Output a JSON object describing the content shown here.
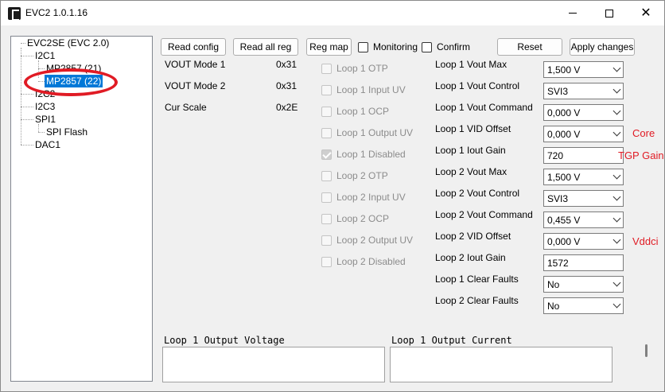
{
  "window": {
    "title": "EVC2 1.0.1.16"
  },
  "tree": {
    "root": "EVC2SE (EVC 2.0)",
    "i2c1": "I2C1",
    "mp2857_21": "MP2857 (21)",
    "mp2857_22": "MP2857 (22)",
    "i2c2": "I2C2",
    "i2c3": "I2C3",
    "spi1": "SPI1",
    "spi_flash": "SPI Flash",
    "dac1": "DAC1"
  },
  "toolbar": {
    "read_config": "Read config",
    "read_all_reg": "Read all reg",
    "reg_map": "Reg map",
    "monitoring": "Monitoring",
    "confirm": "Confirm",
    "reset": "Reset",
    "apply_changes": "Apply changes"
  },
  "info": [
    {
      "label": "VOUT Mode 1",
      "value": "0x31"
    },
    {
      "label": "VOUT Mode 2",
      "value": "0x31"
    },
    {
      "label": "Cur Scale",
      "value": "0x2E"
    }
  ],
  "loop_flags": [
    {
      "label": "Loop 1 OTP",
      "checked": false
    },
    {
      "label": "Loop 1 Input UV",
      "checked": false
    },
    {
      "label": "Loop 1 OCP",
      "checked": false
    },
    {
      "label": "Loop 1 Output UV",
      "checked": false
    },
    {
      "label": "Loop 1 Disabled",
      "checked": true
    },
    {
      "label": "Loop 2 OTP",
      "checked": false
    },
    {
      "label": "Loop 2 Input UV",
      "checked": false
    },
    {
      "label": "Loop 2 OCP",
      "checked": false
    },
    {
      "label": "Loop 2 Output UV",
      "checked": false
    },
    {
      "label": "Loop 2 Disabled",
      "checked": false
    }
  ],
  "params": [
    {
      "label": "Loop 1 Vout Max",
      "value": "1,500 V"
    },
    {
      "label": "Loop 1 Vout Control",
      "value": "SVI3"
    },
    {
      "label": "Loop 1 Vout Command",
      "value": "0,000 V"
    },
    {
      "label": "Loop 1 VID Offset",
      "value": "0,000 V"
    },
    {
      "label": "Loop 1 Iout Gain",
      "value": "720"
    },
    {
      "label": "Loop 2 Vout Max",
      "value": "1,500 V"
    },
    {
      "label": "Loop 2 Vout Control",
      "value": "SVI3"
    },
    {
      "label": "Loop 2 Vout Command",
      "value": "0,455 V"
    },
    {
      "label": "Loop 2 VID Offset",
      "value": "0,000 V"
    },
    {
      "label": "Loop 2 Iout Gain",
      "value": "1572"
    },
    {
      "label": "Loop 1 Clear Faults",
      "value": "No"
    },
    {
      "label": "Loop 2 Clear Faults",
      "value": "No"
    }
  ],
  "annotations": {
    "core": "Core",
    "tgp_gain": "TGP Gain",
    "vddci": "Vddci",
    "highlight_color": "#e01b24"
  },
  "charts": {
    "voltage_title": "Loop 1 Output Voltage",
    "current_title": "Loop 1 Output Current"
  }
}
